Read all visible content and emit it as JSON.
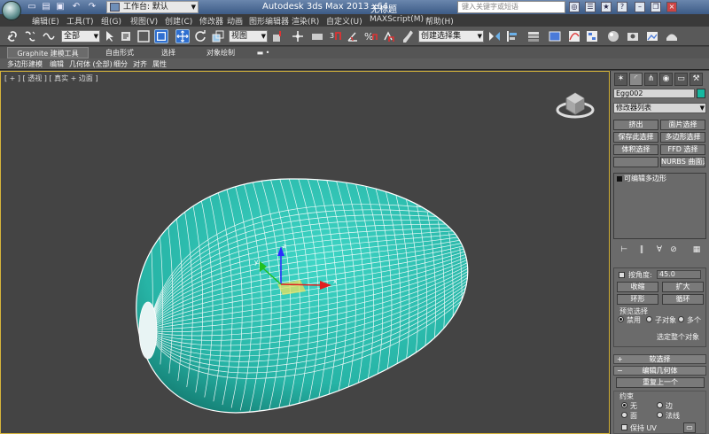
{
  "titlebar": {
    "workspace": "工作台: 默认",
    "title": "Autodesk 3ds Max  2013 x64",
    "file": "无标题",
    "search_placeholder": "键入关键字或短语"
  },
  "menu": {
    "items": [
      "编辑(E)",
      "工具(T)",
      "组(G)",
      "视图(V)",
      "创建(C)",
      "修改器",
      "动画",
      "图形编辑器",
      "渲染(R)",
      "自定义(U)",
      "MAXScript(M)",
      "帮助(H)"
    ]
  },
  "toolbar": {
    "selection_filter": "全部",
    "ref_coord": "视图",
    "named_selection": "创建选择集"
  },
  "ribbon": {
    "tabs": [
      "Graphite 建模工具",
      "自由形式",
      "选择",
      "对象绘制"
    ],
    "subtabs": [
      "多边形建模",
      "编辑",
      "几何体 (全部)",
      "细分",
      "对齐",
      "属性"
    ]
  },
  "viewport": {
    "label": "[ + ] [ 透视 ] [ 真实 + 边面 ]",
    "object_color": "#2cc4b4",
    "wire_color": "#ffffff",
    "border_color": "#d6b43a"
  },
  "command_panel": {
    "object_name": "Egg002",
    "modifier_list": "修改器列表",
    "mod_buttons": [
      "挤出",
      "面片选择",
      "保存此选择",
      "多边形选择",
      "体积选择",
      "FFD 选择",
      "",
      "NURBS 曲面选择"
    ],
    "stack_item": "可编辑多边形",
    "selection": {
      "by_angle_label": "按角度:",
      "by_angle_value": "45.0",
      "shrink": "收缩",
      "grow": "扩大",
      "ring": "环形",
      "loop": "循环",
      "preview_title": "预览选择",
      "preview_options": [
        "禁用",
        "子对象",
        "多个"
      ],
      "select_whole": "选定整个对象"
    },
    "soft_selection": "软选择",
    "edit_geometry": "编辑几何体",
    "repeat_last": "重复上一个",
    "constraints_title": "约束",
    "constraint_options": [
      "无",
      "边",
      "面",
      "法线"
    ],
    "preserve_uv": "保持 UV"
  }
}
